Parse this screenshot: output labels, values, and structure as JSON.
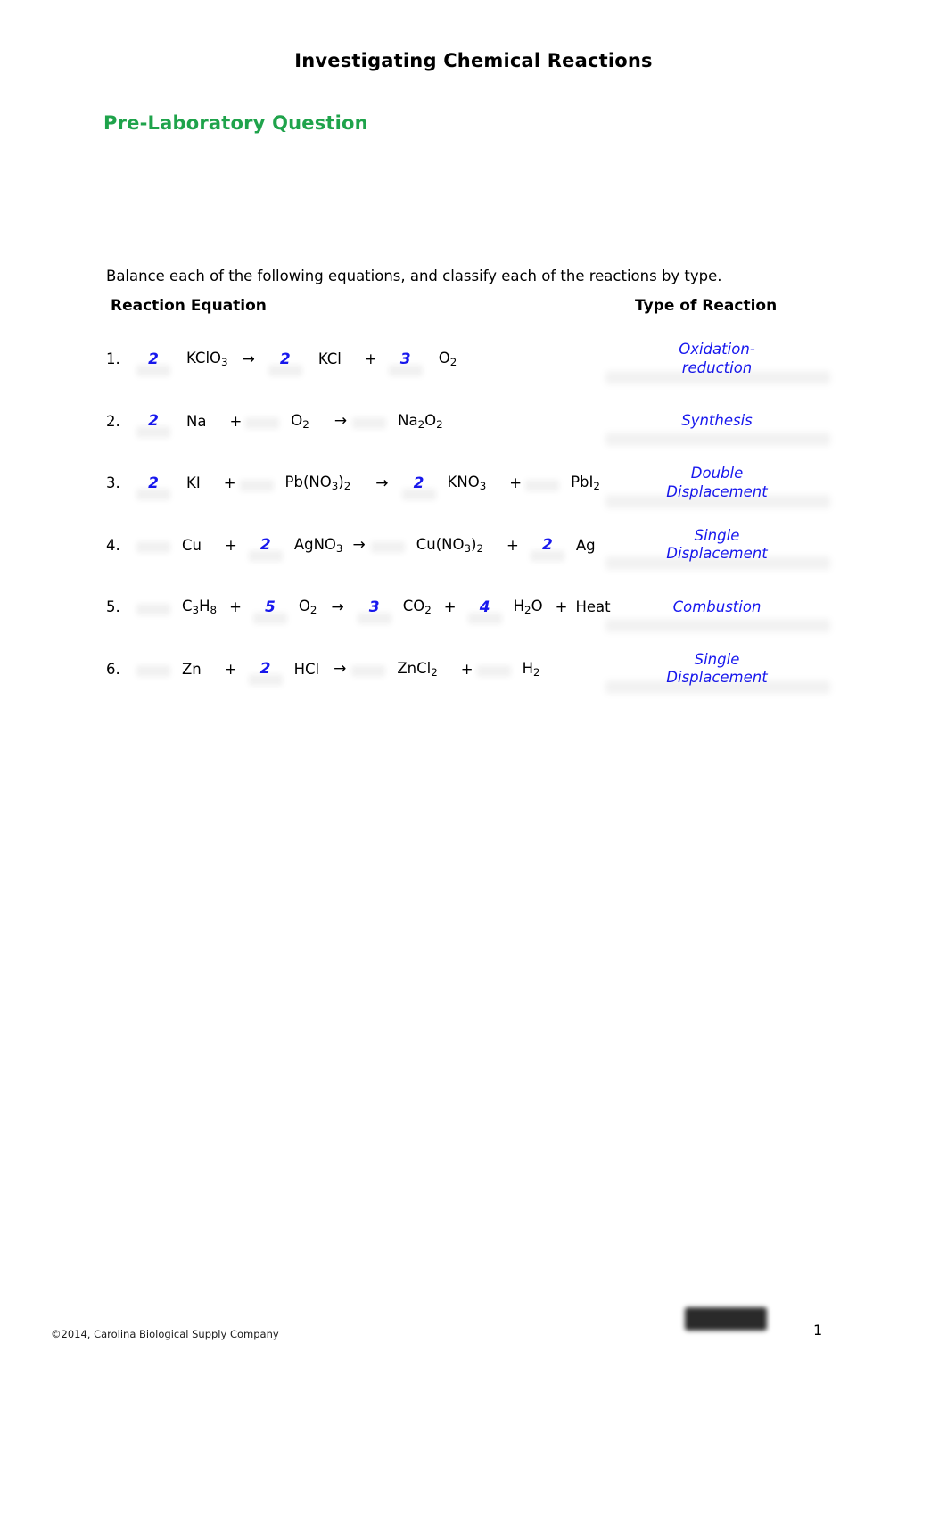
{
  "document": {
    "title": "Investigating Chemical Reactions",
    "section_heading": "Pre-Laboratory Question",
    "instruction": "Balance each of the following equations, and classify each of the reactions by type."
  },
  "table": {
    "header_equation": "Reaction Equation",
    "header_type": "Type of Reaction",
    "rows": [
      {
        "number": "1.",
        "coefficients": [
          "2",
          "",
          "2",
          "",
          "3",
          ""
        ],
        "equation_plain": "2 KClO3 → 2 KCl + 3 O2",
        "reaction_type": "Oxidation-reduction",
        "type_line_1": "Oxidation-",
        "type_line_2": "reduction"
      },
      {
        "number": "2.",
        "coefficients": [
          "2",
          "",
          "",
          ""
        ],
        "equation_plain": "2 Na + O2 → Na2O2",
        "reaction_type": "Synthesis",
        "type_line_1": "Synthesis",
        "type_line_2": ""
      },
      {
        "number": "3.",
        "coefficients": [
          "2",
          "",
          "2",
          ""
        ],
        "equation_plain": "2 KI + Pb(NO3)2 → 2 KNO3 + PbI2",
        "reaction_type": "Double Displacement",
        "type_line_1": "Double",
        "type_line_2": "Displacement"
      },
      {
        "number": "4.",
        "coefficients": [
          "",
          "2",
          "",
          "2"
        ],
        "equation_plain": "Cu + 2 AgNO3 → Cu(NO3)2 + 2 Ag",
        "reaction_type": "Single Displacement",
        "type_line_1": "Single",
        "type_line_2": "Displacement"
      },
      {
        "number": "5.",
        "coefficients": [
          "",
          "5",
          "3",
          "4"
        ],
        "equation_plain": "C3H8 + 5 O2 → 3 CO2 + 4 H2O + Heat",
        "reaction_type": "Combustion",
        "type_line_1": "Combustion",
        "type_line_2": ""
      },
      {
        "number": "6.",
        "coefficients": [
          "",
          "2",
          "",
          ""
        ],
        "equation_plain": "Zn + 2 HCl → ZnCl2 + H2",
        "reaction_type": "Single Displacement",
        "type_line_1": "Single",
        "type_line_2": "Displacement"
      }
    ],
    "symbols": {
      "plus": "+",
      "arrow": "→"
    },
    "species": {
      "r1": {
        "a": "KClO",
        "a_sub": "3",
        "b": "KCl",
        "c": "O",
        "c_sub": "2"
      },
      "r2": {
        "a": "Na",
        "b": "O",
        "b_sub": "2",
        "c1": "Na",
        "c1_sub": "2",
        "c2": "O",
        "c2_sub": "2"
      },
      "r3": {
        "a": "KI",
        "b1": "Pb(NO",
        "b1_sub": "3",
        "b2": ")",
        "b2_sub": "2",
        "c": "KNO",
        "c_sub": "3",
        "d": "PbI",
        "d_sub": "2"
      },
      "r4": {
        "a": "Cu",
        "b": "AgNO",
        "b_sub": "3",
        "c1": "Cu(NO",
        "c1_sub": "3",
        "c2": ")",
        "c2_sub": "2",
        "d": "Ag"
      },
      "r5": {
        "a1": "C",
        "a1_sub": "3",
        "a2": "H",
        "a2_sub": "8",
        "b": "O",
        "b_sub": "2",
        "c": "CO",
        "c_sub": "2",
        "d1": "H",
        "d1_sub": "2",
        "d2": "O",
        "e": "Heat"
      },
      "r6": {
        "a": "Zn",
        "b": "HCl",
        "c": "ZnCl",
        "c_sub": "2",
        "d": "H",
        "d_sub": "2"
      }
    }
  },
  "footer": {
    "copyright": "©2014, Carolina Biological Supply Company",
    "page_number": "1"
  },
  "colors": {
    "heading_green": "#1fa34b",
    "answer_blue": "#1818ee",
    "text_black": "#000000"
  }
}
